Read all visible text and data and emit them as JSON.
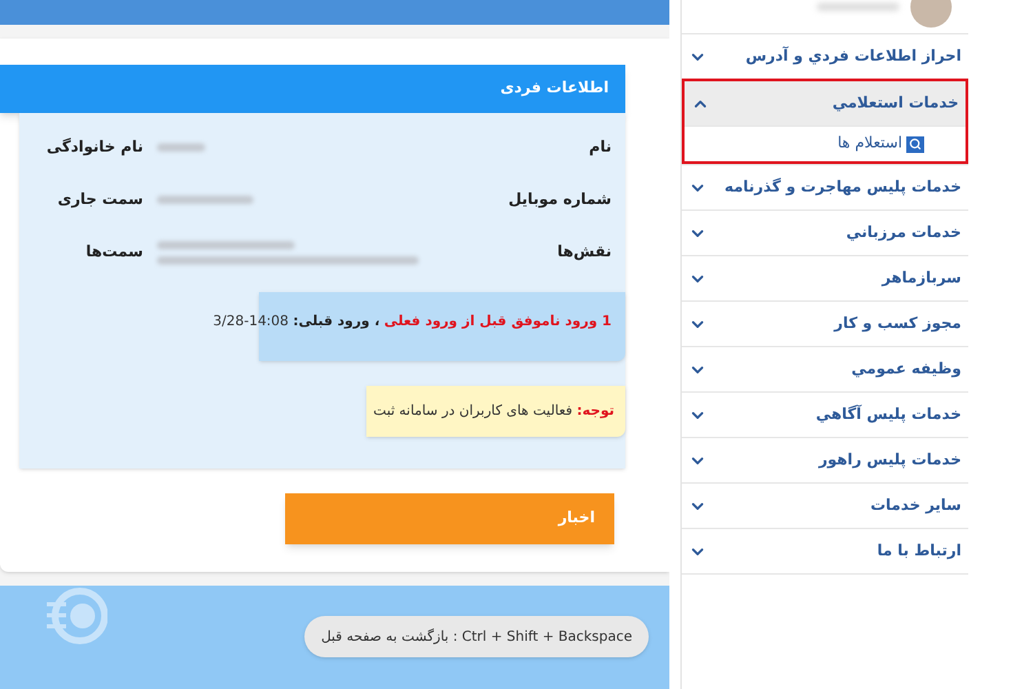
{
  "panel": {
    "title": "اطلاعات فردی",
    "fields": [
      {
        "label": "نام",
        "side_label": "نام خانوادگی"
      },
      {
        "label": "شماره موبایل",
        "side_label": "سمت جاری"
      },
      {
        "label": "نقش‌ها",
        "side_label": "سمت‌ها"
      }
    ],
    "login_message": [
      {
        "kind": "alert",
        "text": "1 ورود ناموفق قبل از ورود فعلی"
      },
      {
        "kind": "label",
        "text": "، ورود قبلی:"
      },
      {
        "kind": "value",
        "text": "3/28-14:08"
      }
    ],
    "notice": [
      {
        "kind": "alert",
        "text": "توجه:"
      },
      {
        "kind": "value",
        "text": "فعالیت های کاربران در سامانه ثبت"
      }
    ],
    "news_title": "اخبار"
  },
  "footer": {
    "shortcut": "Ctrl + Shift + Backspace : بازگشت به صفحه قبل"
  },
  "sidebar": {
    "items": [
      {
        "label": "احراز اطلاعات فردي و آدرس",
        "expanded": false,
        "highlighted": false
      },
      {
        "label": "خدمات استعلامي",
        "expanded": true,
        "highlighted": true,
        "children": [
          {
            "label": "استعلام ها"
          }
        ]
      },
      {
        "label": "خدمات پليس مهاجرت و گذرنامه",
        "expanded": false,
        "highlighted": false
      },
      {
        "label": "خدمات مرزباني",
        "expanded": false,
        "highlighted": false
      },
      {
        "label": "سربازماهر",
        "expanded": false,
        "highlighted": false
      },
      {
        "label": "مجوز کسب و کار",
        "expanded": false,
        "highlighted": false
      },
      {
        "label": "وظيفه عمومي",
        "expanded": false,
        "highlighted": false
      },
      {
        "label": "خدمات پليس آگاهي",
        "expanded": false,
        "highlighted": false
      },
      {
        "label": "خدمات پليس راهور",
        "expanded": false,
        "highlighted": false
      },
      {
        "label": "ساير خدمات",
        "expanded": false,
        "highlighted": false
      },
      {
        "label": "ارتباط با ما",
        "expanded": false,
        "highlighted": false
      }
    ]
  }
}
